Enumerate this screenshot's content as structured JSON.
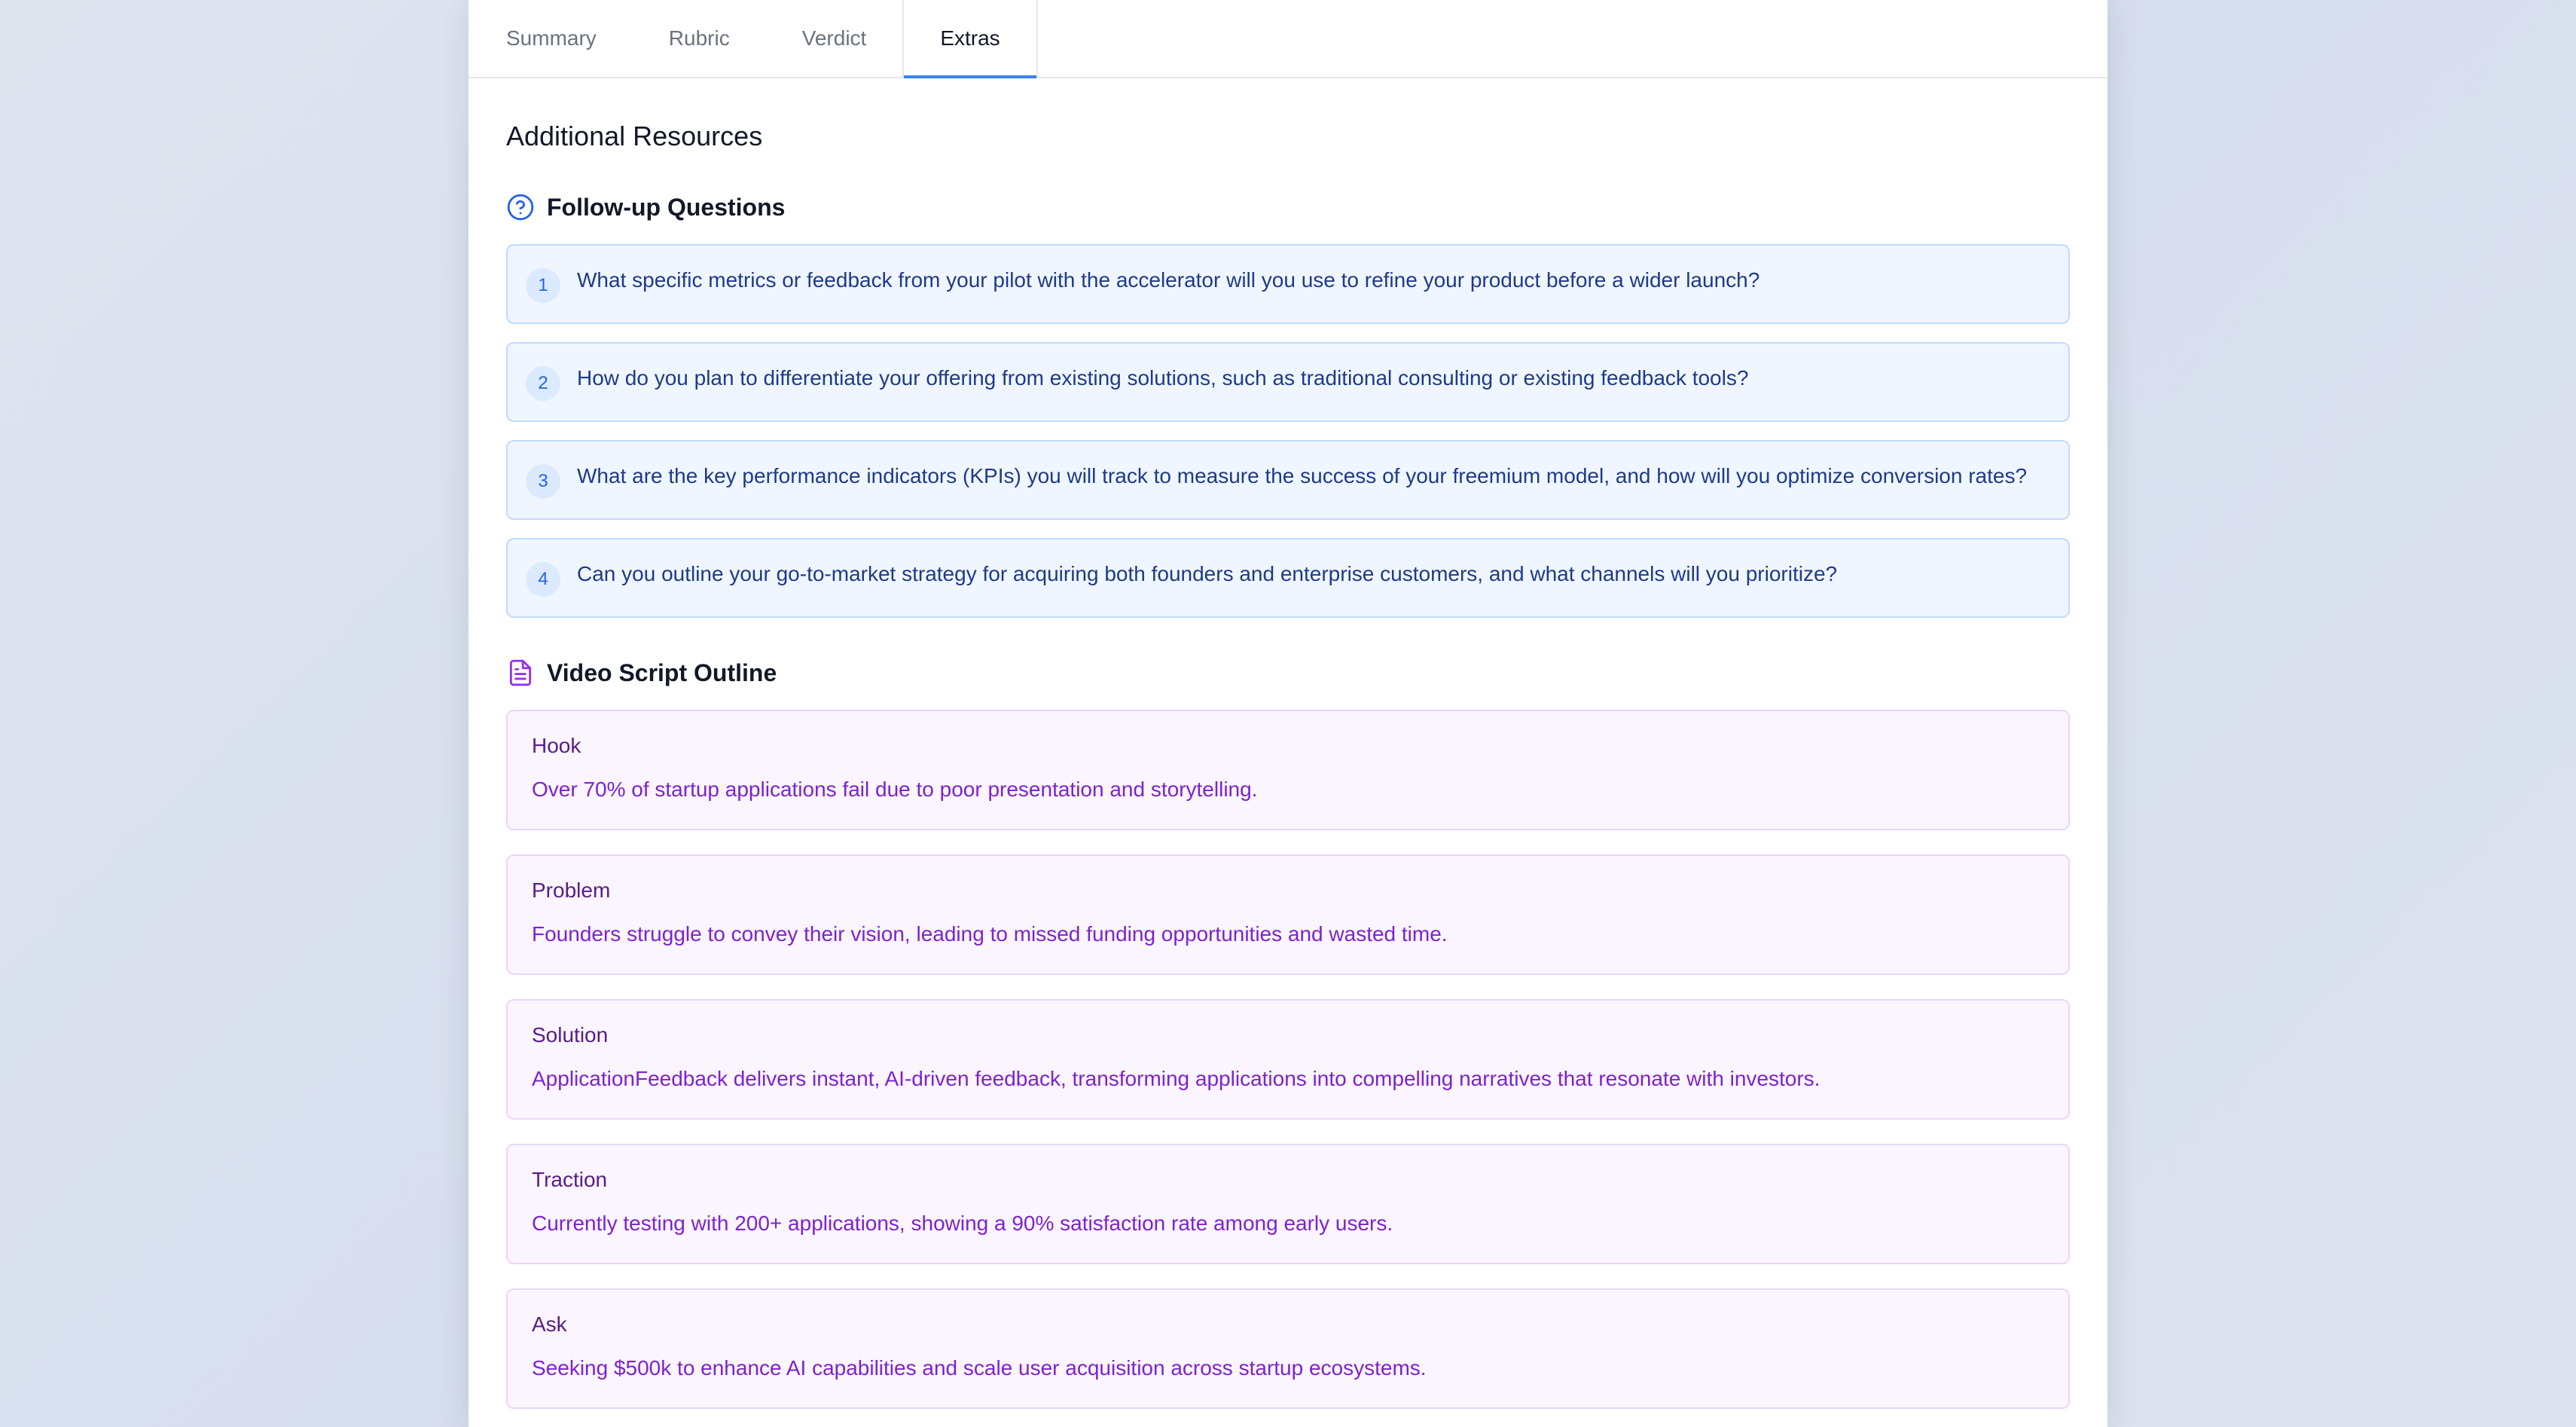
{
  "tabs": [
    {
      "label": "Summary",
      "active": false
    },
    {
      "label": "Rubric",
      "active": false
    },
    {
      "label": "Verdict",
      "active": false
    },
    {
      "label": "Extras",
      "active": true
    }
  ],
  "page": {
    "title": "Additional Resources"
  },
  "followup": {
    "title": "Follow-up Questions",
    "icon": "question-circle-icon",
    "items": [
      {
        "num": "1",
        "text": "What specific metrics or feedback from your pilot with the accelerator will you use to refine your product before a wider launch?"
      },
      {
        "num": "2",
        "text": "How do you plan to differentiate your offering from existing solutions, such as traditional consulting or existing feedback tools?"
      },
      {
        "num": "3",
        "text": "What are the key performance indicators (KPIs) you will track to measure the success of your freemium model, and how will you optimize conversion rates?"
      },
      {
        "num": "4",
        "text": "Can you outline your go-to-market strategy for acquiring both founders and enterprise customers, and what channels will you prioritize?"
      }
    ]
  },
  "script": {
    "title": "Video Script Outline",
    "icon": "document-icon",
    "items": [
      {
        "title": "Hook",
        "text": "Over 70% of startup applications fail due to poor presentation and storytelling."
      },
      {
        "title": "Problem",
        "text": "Founders struggle to convey their vision, leading to missed funding opportunities and wasted time."
      },
      {
        "title": "Solution",
        "text": "ApplicationFeedback delivers instant, AI-driven feedback, transforming applications into compelling narratives that resonate with investors."
      },
      {
        "title": "Traction",
        "text": "Currently testing with 200+ applications, showing a 90% satisfaction rate among early users."
      },
      {
        "title": "Ask",
        "text": "Seeking $500k to enhance AI capabilities and scale user acquisition across startup ecosystems."
      }
    ]
  },
  "colors": {
    "accent": "#3b82f6",
    "question_bg": "#eff6ff",
    "question_text": "#1e3a8a",
    "script_bg": "#faf5ff",
    "script_text": "#7e22ce"
  }
}
